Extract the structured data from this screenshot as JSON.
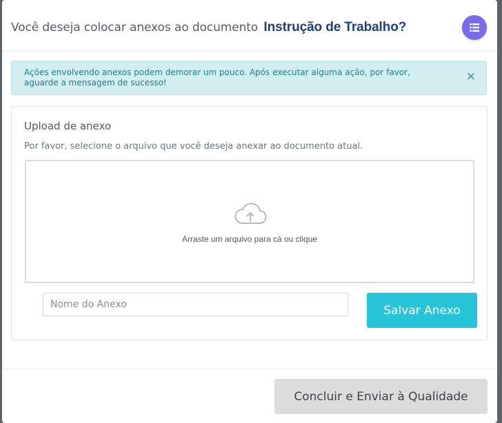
{
  "modal": {
    "title_prefix": "Você deseja colocar anexos ao documento",
    "document_name": "Instrução de Trabalho?",
    "header_button_icon": "list-icon",
    "accent_color": "#7a6bea"
  },
  "alert": {
    "message": "Ações envolvendo anexos podem demorar um pouco. Após executar alguma ação, por favor, aguarde a mensagem de sucesso!",
    "close_label": "×",
    "color": "#d3eef1"
  },
  "upload": {
    "title": "Upload de anexo",
    "description": "Por favor, selecione o arquivo que você deseja anexar ao documento atual.",
    "dropzone_icon": "cloud-upload-icon",
    "dropzone_text": "Arraste um arquivo para cá ou clique",
    "name_value": "",
    "name_placeholder": "Nome do Anexo",
    "save_label": "Salvar Anexo",
    "save_color": "#27c4d8"
  },
  "footer": {
    "submit_label": "Concluir e Enviar à Qualidade"
  }
}
